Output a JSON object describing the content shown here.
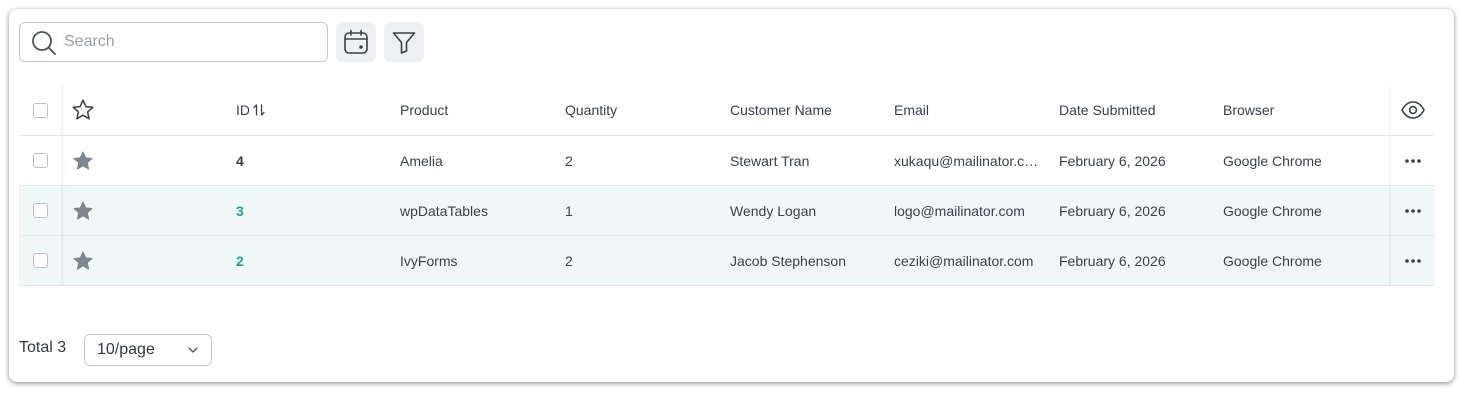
{
  "search": {
    "placeholder": "Search",
    "value": ""
  },
  "toolbar": {
    "calendar_icon": "calendar-icon",
    "filter_icon": "filter-icon"
  },
  "table": {
    "headers": {
      "id": "ID",
      "product": "Product",
      "quantity": "Quantity",
      "customer_name": "Customer Name",
      "email": "Email",
      "date_submitted": "Date Submitted",
      "browser": "Browser"
    },
    "rows": [
      {
        "id": "4",
        "product": "Amelia",
        "quantity": "2",
        "customer_name": "Stewart Tran",
        "email": "xukaqu@mailinator.co…",
        "date_submitted": "February 6, 2026",
        "browser": "Google Chrome",
        "highlighted": false
      },
      {
        "id": "3",
        "product": "wpDataTables",
        "quantity": "1",
        "customer_name": "Wendy Logan",
        "email": "logo@mailinator.com",
        "date_submitted": "February 6, 2026",
        "browser": "Google Chrome",
        "highlighted": true
      },
      {
        "id": "2",
        "product": "IvyForms",
        "quantity": "2",
        "customer_name": "Jacob Stephenson",
        "email": "ceziki@mailinator.com",
        "date_submitted": "February 6, 2026",
        "browser": "Google Chrome",
        "highlighted": true
      }
    ]
  },
  "footer": {
    "total_label": "Total 3",
    "page_size": "10/page"
  },
  "colors": {
    "accent": "#1aa39a",
    "row_highlight": "#f0f8f7",
    "star": "#7d8590",
    "border": "#e3e6ea"
  }
}
